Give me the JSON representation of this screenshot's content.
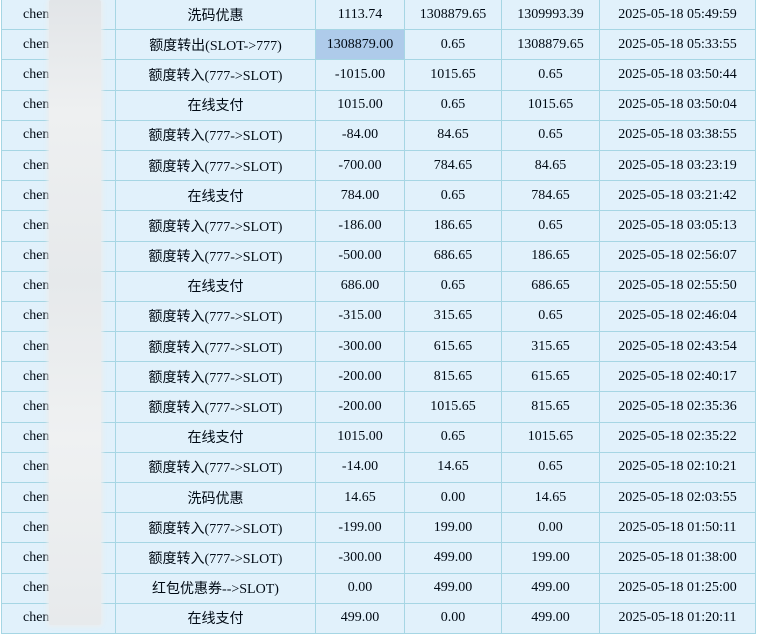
{
  "table": {
    "row_count": 21,
    "columns": [
      "username",
      "type",
      "amount",
      "balance_before",
      "balance_after",
      "time"
    ],
    "highlighted_cell": {
      "row_index": 1,
      "column": "amount"
    },
    "colors": {
      "row_bg": "#e1f1fb",
      "border": "#a6d6e4",
      "highlight_bg": "#aecbea",
      "text": "#000a14",
      "page_bg": "#ffffff",
      "redaction_strip": "#e9ebed"
    },
    "rows": [
      {
        "username": "chen",
        "type": "洗码优惠",
        "amount": "1113.74",
        "balance_before": "1308879.65",
        "balance_after": "1309993.39",
        "time": "2025-05-18 05:49:59",
        "amount_highlighted": false
      },
      {
        "username": "chen",
        "type": "额度转出(SLOT->777)",
        "amount": "1308879.00",
        "balance_before": "0.65",
        "balance_after": "1308879.65",
        "time": "2025-05-18 05:33:55",
        "amount_highlighted": true
      },
      {
        "username": "chen",
        "type": "额度转入(777->SLOT)",
        "amount": "-1015.00",
        "balance_before": "1015.65",
        "balance_after": "0.65",
        "time": "2025-05-18 03:50:44",
        "amount_highlighted": false
      },
      {
        "username": "chen",
        "type": "在线支付",
        "amount": "1015.00",
        "balance_before": "0.65",
        "balance_after": "1015.65",
        "time": "2025-05-18 03:50:04",
        "amount_highlighted": false
      },
      {
        "username": "chen",
        "type": "额度转入(777->SLOT)",
        "amount": "-84.00",
        "balance_before": "84.65",
        "balance_after": "0.65",
        "time": "2025-05-18 03:38:55",
        "amount_highlighted": false
      },
      {
        "username": "chen",
        "type": "额度转入(777->SLOT)",
        "amount": "-700.00",
        "balance_before": "784.65",
        "balance_after": "84.65",
        "time": "2025-05-18 03:23:19",
        "amount_highlighted": false
      },
      {
        "username": "chen",
        "type": "在线支付",
        "amount": "784.00",
        "balance_before": "0.65",
        "balance_after": "784.65",
        "time": "2025-05-18 03:21:42",
        "amount_highlighted": false
      },
      {
        "username": "chen",
        "type": "额度转入(777->SLOT)",
        "amount": "-186.00",
        "balance_before": "186.65",
        "balance_after": "0.65",
        "time": "2025-05-18 03:05:13",
        "amount_highlighted": false
      },
      {
        "username": "chen",
        "type": "额度转入(777->SLOT)",
        "amount": "-500.00",
        "balance_before": "686.65",
        "balance_after": "186.65",
        "time": "2025-05-18 02:56:07",
        "amount_highlighted": false
      },
      {
        "username": "chen",
        "type": "在线支付",
        "amount": "686.00",
        "balance_before": "0.65",
        "balance_after": "686.65",
        "time": "2025-05-18 02:55:50",
        "amount_highlighted": false
      },
      {
        "username": "chen",
        "type": "额度转入(777->SLOT)",
        "amount": "-315.00",
        "balance_before": "315.65",
        "balance_after": "0.65",
        "time": "2025-05-18 02:46:04",
        "amount_highlighted": false
      },
      {
        "username": "chen",
        "type": "额度转入(777->SLOT)",
        "amount": "-300.00",
        "balance_before": "615.65",
        "balance_after": "315.65",
        "time": "2025-05-18 02:43:54",
        "amount_highlighted": false
      },
      {
        "username": "chen",
        "type": "额度转入(777->SLOT)",
        "amount": "-200.00",
        "balance_before": "815.65",
        "balance_after": "615.65",
        "time": "2025-05-18 02:40:17",
        "amount_highlighted": false
      },
      {
        "username": "chen",
        "type": "额度转入(777->SLOT)",
        "amount": "-200.00",
        "balance_before": "1015.65",
        "balance_after": "815.65",
        "time": "2025-05-18 02:35:36",
        "amount_highlighted": false
      },
      {
        "username": "chen",
        "type": "在线支付",
        "amount": "1015.00",
        "balance_before": "0.65",
        "balance_after": "1015.65",
        "time": "2025-05-18 02:35:22",
        "amount_highlighted": false
      },
      {
        "username": "chen",
        "type": "额度转入(777->SLOT)",
        "amount": "-14.00",
        "balance_before": "14.65",
        "balance_after": "0.65",
        "time": "2025-05-18 02:10:21",
        "amount_highlighted": false
      },
      {
        "username": "chen",
        "type": "洗码优惠",
        "amount": "14.65",
        "balance_before": "0.00",
        "balance_after": "14.65",
        "time": "2025-05-18 02:03:55",
        "amount_highlighted": false
      },
      {
        "username": "chen",
        "type": "额度转入(777->SLOT)",
        "amount": "-199.00",
        "balance_before": "199.00",
        "balance_after": "0.00",
        "time": "2025-05-18 01:50:11",
        "amount_highlighted": false
      },
      {
        "username": "chen",
        "type": "额度转入(777->SLOT)",
        "amount": "-300.00",
        "balance_before": "499.00",
        "balance_after": "199.00",
        "time": "2025-05-18 01:38:00",
        "amount_highlighted": false
      },
      {
        "username": "chen",
        "type": "红包优惠券-->SLOT)",
        "amount": "0.00",
        "balance_before": "499.00",
        "balance_after": "499.00",
        "time": "2025-05-18 01:25:00",
        "amount_highlighted": false
      },
      {
        "username": "chen",
        "type": "在线支付",
        "amount": "499.00",
        "balance_before": "0.00",
        "balance_after": "499.00",
        "time": "2025-05-18 01:20:11",
        "amount_highlighted": false
      }
    ]
  }
}
